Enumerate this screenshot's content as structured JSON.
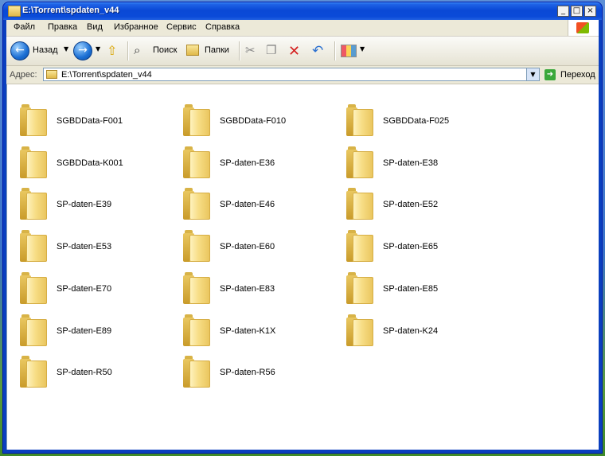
{
  "window": {
    "title": "E:\\Torrent\\spdaten_v44",
    "controls": {
      "minimize": "_",
      "maximize": "□",
      "close": "×"
    }
  },
  "menu": [
    "Файл",
    "Правка",
    "Вид",
    "Избранное",
    "Сервис",
    "Справка"
  ],
  "toolbar": {
    "back_label": "Назад",
    "search_label": "Поиск",
    "folders_label": "Папки"
  },
  "address": {
    "label": "Адрес:",
    "path": "E:\\Torrent\\spdaten_v44",
    "go_label": "Переход"
  },
  "folders": [
    "SGBDData-F001",
    "SGBDData-F010",
    "SGBDData-F025",
    "SGBDData-K001",
    "SP-daten-E36",
    "SP-daten-E38",
    "SP-daten-E39",
    "SP-daten-E46",
    "SP-daten-E52",
    "SP-daten-E53",
    "SP-daten-E60",
    "SP-daten-E65",
    "SP-daten-E70",
    "SP-daten-E83",
    "SP-daten-E85",
    "SP-daten-E89",
    "SP-daten-K1X",
    "SP-daten-K24",
    "SP-daten-R50",
    "SP-daten-R56"
  ],
  "colors": {
    "titlebar": "#0a49d6",
    "chrome": "#ece9d8",
    "folder": "#f7dd85"
  }
}
